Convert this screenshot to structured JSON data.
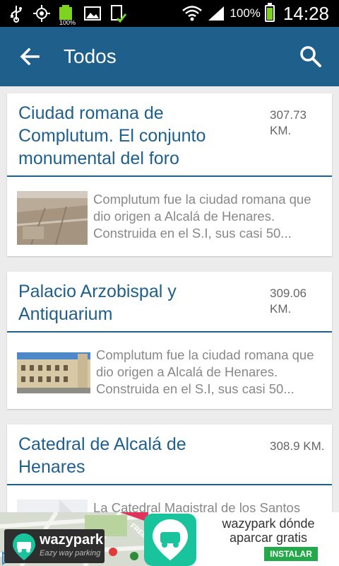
{
  "status_bar": {
    "battery_percent": "100%",
    "time": "14:28",
    "small_battery_label": "100%"
  },
  "app_bar": {
    "title": "Todos"
  },
  "items": [
    {
      "title": "Ciudad romana de Complutum. El conjunto monumental del foro",
      "distance": "307.73 KM.",
      "description": "Complutum fue la ciudad romana que dio origen a Alcalá de Henares. Construida en el S.I, sus casi 50..."
    },
    {
      "title": "Palacio Arzobispal y Antiquarium",
      "distance": "309.06 KM.",
      "description": "Complutum fue la ciudad romana que dio origen a Alcalá de Henares. Construida en el S.I, sus casi 50..."
    },
    {
      "title": "Catedral de Alcalá de Henares",
      "distance": "308.9 KM.",
      "description": "La Catedral Magistral de los Santos Niños Justo y Pastor..."
    }
  ],
  "ad": {
    "brand": "wazypark",
    "tagline": "Eazy way parking",
    "headline": "wazypark dónde aparcar gratis",
    "button": "INSTALAR",
    "ribbon": "FREE"
  },
  "colors": {
    "primary": "#1f5f8c",
    "ad_green": "#23a84a",
    "app_icon": "#19c39b"
  }
}
